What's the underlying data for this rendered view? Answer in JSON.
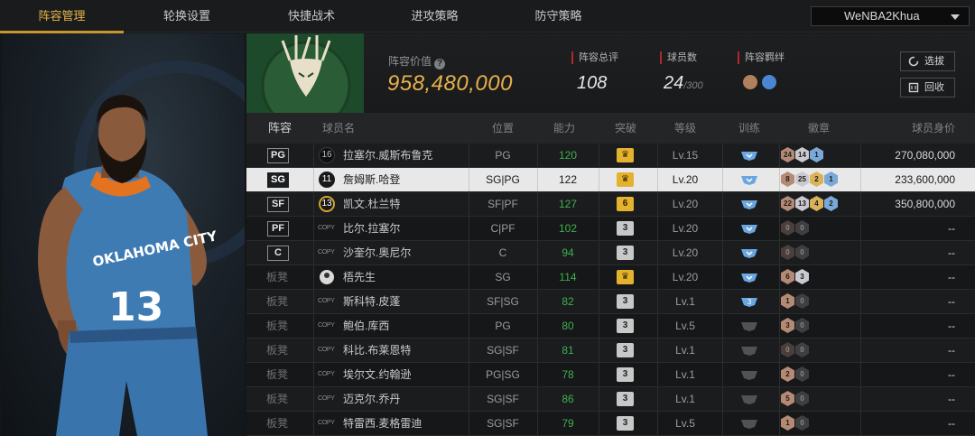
{
  "nav": {
    "tabs": [
      {
        "label": "阵容管理",
        "active": true
      },
      {
        "label": "轮换设置",
        "active": false
      },
      {
        "label": "快捷战术",
        "active": false
      },
      {
        "label": "进攻策略",
        "active": false
      },
      {
        "label": "防守策略",
        "active": false
      }
    ],
    "account": "WeNBA2Khua"
  },
  "summary": {
    "lineup_value_label": "阵容价值",
    "lineup_value": "958,480,000",
    "overall_label": "阵容总评",
    "overall": "108",
    "players_label": "球员数",
    "players": "24",
    "players_max": "/300",
    "bond_label": "阵容羁绊",
    "pick_button": "选拔",
    "recycle_button": "回收"
  },
  "table": {
    "headers": [
      "阵容",
      "球员名",
      "位置",
      "能力",
      "突破",
      "等级",
      "训练",
      "徽章",
      "球员身价"
    ],
    "rows": [
      {
        "slot": "PG",
        "is_bench": false,
        "num": "16",
        "num_style": "normal",
        "name": "拉塞尔.威斯布鲁克",
        "pos": "PG",
        "ability": "120",
        "green": true,
        "break": "crown",
        "level": "Lv.15",
        "train": "blue",
        "badges": [
          {
            "t": "24",
            "c": "#b48a74"
          },
          {
            "t": "14",
            "c": "#c9c9cf"
          },
          {
            "t": "1",
            "c": "#7aa9d8"
          }
        ],
        "value": "270,080,000"
      },
      {
        "slot": "SG",
        "is_bench": false,
        "num": "11",
        "num_style": "gold",
        "name": "詹姆斯.哈登",
        "pos": "SG|PG",
        "ability": "122",
        "green": false,
        "break": "crown",
        "level": "Lv.20",
        "train": "blue",
        "badges": [
          {
            "t": "8",
            "c": "#b48a74"
          },
          {
            "t": "25",
            "c": "#c9c9cf"
          },
          {
            "t": "2",
            "c": "#d9b25a"
          },
          {
            "t": "1",
            "c": "#7aa9d8"
          }
        ],
        "value": "233,600,000",
        "selected": true
      },
      {
        "slot": "SF",
        "is_bench": false,
        "num": "13",
        "num_style": "gold",
        "name": "凯文.杜兰特",
        "pos": "SF|PF",
        "ability": "127",
        "green": true,
        "break": "6",
        "break_style": "gold",
        "level": "Lv.20",
        "train": "blue",
        "badges": [
          {
            "t": "22",
            "c": "#b48a74"
          },
          {
            "t": "13",
            "c": "#c9c9cf"
          },
          {
            "t": "4",
            "c": "#d9b25a"
          },
          {
            "t": "2",
            "c": "#7aa9d8"
          }
        ],
        "value": "350,800,000"
      },
      {
        "slot": "PF",
        "is_bench": false,
        "num": "COPY",
        "num_style": "copy",
        "name": "比尔.拉塞尔",
        "pos": "C|PF",
        "ability": "102",
        "green": true,
        "break": "3",
        "break_style": "gray",
        "level": "Lv.20",
        "train": "blue",
        "badges": [
          {
            "t": "0",
            "c": "#4a3f3a"
          },
          {
            "t": "0",
            "c": "#3f3f42"
          }
        ],
        "value": "--"
      },
      {
        "slot": "C",
        "is_bench": false,
        "num": "COPY",
        "num_style": "copy",
        "name": "沙奎尔.奥尼尔",
        "pos": "C",
        "ability": "94",
        "green": true,
        "break": "3",
        "break_style": "gray",
        "level": "Lv.20",
        "train": "blue",
        "badges": [
          {
            "t": "0",
            "c": "#4a3f3a"
          },
          {
            "t": "0",
            "c": "#3f3f42"
          }
        ],
        "value": "--"
      },
      {
        "slot": "板凳",
        "is_bench": true,
        "num": "",
        "num_style": "user",
        "name": "梧先生",
        "pos": "SG",
        "ability": "114",
        "green": true,
        "break": "crown",
        "level": "Lv.20",
        "train": "blue",
        "badges": [
          {
            "t": "6",
            "c": "#b48a74"
          },
          {
            "t": "3",
            "c": "#c9c9cf"
          }
        ],
        "value": "--"
      },
      {
        "slot": "板凳",
        "is_bench": true,
        "num": "COPY",
        "num_style": "copy",
        "name": "斯科特.皮蓬",
        "pos": "SF|SG",
        "ability": "82",
        "green": true,
        "break": "3",
        "break_style": "gray",
        "level": "Lv.1",
        "train": "blue3",
        "badges": [
          {
            "t": "1",
            "c": "#b48a74"
          },
          {
            "t": "0",
            "c": "#3f3f42"
          }
        ],
        "value": "--"
      },
      {
        "slot": "板凳",
        "is_bench": true,
        "num": "COPY",
        "num_style": "copy",
        "name": "鲍伯.库西",
        "pos": "PG",
        "ability": "80",
        "green": true,
        "break": "3",
        "break_style": "gray",
        "level": "Lv.5",
        "train": "gray",
        "badges": [
          {
            "t": "3",
            "c": "#b48a74"
          },
          {
            "t": "0",
            "c": "#3f3f42"
          }
        ],
        "value": "--"
      },
      {
        "slot": "板凳",
        "is_bench": true,
        "num": "COPY",
        "num_style": "copy",
        "name": "科比.布莱恩特",
        "pos": "SG|SF",
        "ability": "81",
        "green": true,
        "break": "3",
        "break_style": "gray",
        "level": "Lv.1",
        "train": "gray",
        "badges": [
          {
            "t": "0",
            "c": "#4a3f3a"
          },
          {
            "t": "0",
            "c": "#3f3f42"
          }
        ],
        "value": "--"
      },
      {
        "slot": "板凳",
        "is_bench": true,
        "num": "COPY",
        "num_style": "copy",
        "name": "埃尔文.约翰逊",
        "pos": "PG|SG",
        "ability": "78",
        "green": true,
        "break": "3",
        "break_style": "gray",
        "level": "Lv.1",
        "train": "gray",
        "badges": [
          {
            "t": "2",
            "c": "#b48a74"
          },
          {
            "t": "0",
            "c": "#3f3f42"
          }
        ],
        "value": "--"
      },
      {
        "slot": "板凳",
        "is_bench": true,
        "num": "COPY",
        "num_style": "copy",
        "name": "迈克尔.乔丹",
        "pos": "SG|SF",
        "ability": "86",
        "green": true,
        "break": "3",
        "break_style": "gray",
        "level": "Lv.1",
        "train": "gray",
        "badges": [
          {
            "t": "5",
            "c": "#b48a74"
          },
          {
            "t": "0",
            "c": "#3f3f42"
          }
        ],
        "value": "--"
      },
      {
        "slot": "板凳",
        "is_bench": true,
        "num": "COPY",
        "num_style": "copy",
        "name": "特雷西.麦格雷迪",
        "pos": "SG|SF",
        "ability": "79",
        "green": true,
        "break": "3",
        "break_style": "gray",
        "level": "Lv.5",
        "train": "gray",
        "badges": [
          {
            "t": "1",
            "c": "#b48a74"
          },
          {
            "t": "0",
            "c": "#3f3f42"
          }
        ],
        "value": "--"
      }
    ]
  },
  "player_art": {
    "jersey_team": "OKLAHOMA CITY",
    "jersey_number": "13"
  }
}
